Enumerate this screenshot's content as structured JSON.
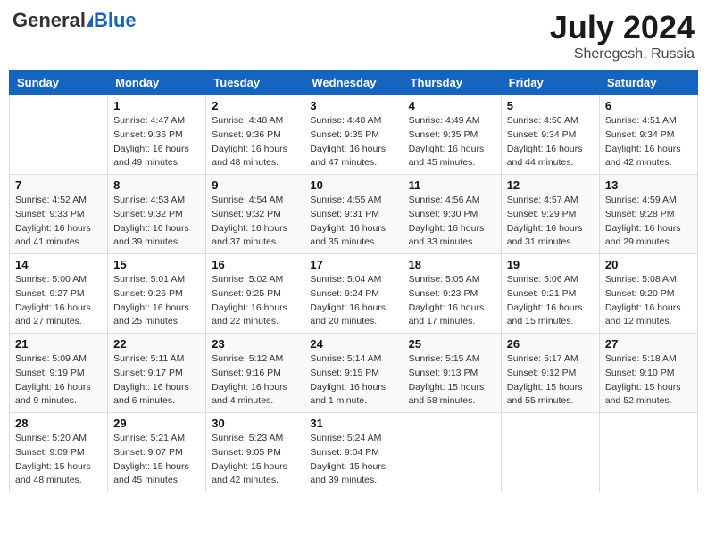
{
  "header": {
    "logo_general": "General",
    "logo_blue": "Blue",
    "title": "July 2024",
    "location": "Sheregesh, Russia"
  },
  "days_of_week": [
    "Sunday",
    "Monday",
    "Tuesday",
    "Wednesday",
    "Thursday",
    "Friday",
    "Saturday"
  ],
  "weeks": [
    [
      {
        "day": "",
        "sunrise": "",
        "sunset": "",
        "daylight": ""
      },
      {
        "day": "1",
        "sunrise": "Sunrise: 4:47 AM",
        "sunset": "Sunset: 9:36 PM",
        "daylight": "Daylight: 16 hours and 49 minutes."
      },
      {
        "day": "2",
        "sunrise": "Sunrise: 4:48 AM",
        "sunset": "Sunset: 9:36 PM",
        "daylight": "Daylight: 16 hours and 48 minutes."
      },
      {
        "day": "3",
        "sunrise": "Sunrise: 4:48 AM",
        "sunset": "Sunset: 9:35 PM",
        "daylight": "Daylight: 16 hours and 47 minutes."
      },
      {
        "day": "4",
        "sunrise": "Sunrise: 4:49 AM",
        "sunset": "Sunset: 9:35 PM",
        "daylight": "Daylight: 16 hours and 45 minutes."
      },
      {
        "day": "5",
        "sunrise": "Sunrise: 4:50 AM",
        "sunset": "Sunset: 9:34 PM",
        "daylight": "Daylight: 16 hours and 44 minutes."
      },
      {
        "day": "6",
        "sunrise": "Sunrise: 4:51 AM",
        "sunset": "Sunset: 9:34 PM",
        "daylight": "Daylight: 16 hours and 42 minutes."
      }
    ],
    [
      {
        "day": "7",
        "sunrise": "Sunrise: 4:52 AM",
        "sunset": "Sunset: 9:33 PM",
        "daylight": "Daylight: 16 hours and 41 minutes."
      },
      {
        "day": "8",
        "sunrise": "Sunrise: 4:53 AM",
        "sunset": "Sunset: 9:32 PM",
        "daylight": "Daylight: 16 hours and 39 minutes."
      },
      {
        "day": "9",
        "sunrise": "Sunrise: 4:54 AM",
        "sunset": "Sunset: 9:32 PM",
        "daylight": "Daylight: 16 hours and 37 minutes."
      },
      {
        "day": "10",
        "sunrise": "Sunrise: 4:55 AM",
        "sunset": "Sunset: 9:31 PM",
        "daylight": "Daylight: 16 hours and 35 minutes."
      },
      {
        "day": "11",
        "sunrise": "Sunrise: 4:56 AM",
        "sunset": "Sunset: 9:30 PM",
        "daylight": "Daylight: 16 hours and 33 minutes."
      },
      {
        "day": "12",
        "sunrise": "Sunrise: 4:57 AM",
        "sunset": "Sunset: 9:29 PM",
        "daylight": "Daylight: 16 hours and 31 minutes."
      },
      {
        "day": "13",
        "sunrise": "Sunrise: 4:59 AM",
        "sunset": "Sunset: 9:28 PM",
        "daylight": "Daylight: 16 hours and 29 minutes."
      }
    ],
    [
      {
        "day": "14",
        "sunrise": "Sunrise: 5:00 AM",
        "sunset": "Sunset: 9:27 PM",
        "daylight": "Daylight: 16 hours and 27 minutes."
      },
      {
        "day": "15",
        "sunrise": "Sunrise: 5:01 AM",
        "sunset": "Sunset: 9:26 PM",
        "daylight": "Daylight: 16 hours and 25 minutes."
      },
      {
        "day": "16",
        "sunrise": "Sunrise: 5:02 AM",
        "sunset": "Sunset: 9:25 PM",
        "daylight": "Daylight: 16 hours and 22 minutes."
      },
      {
        "day": "17",
        "sunrise": "Sunrise: 5:04 AM",
        "sunset": "Sunset: 9:24 PM",
        "daylight": "Daylight: 16 hours and 20 minutes."
      },
      {
        "day": "18",
        "sunrise": "Sunrise: 5:05 AM",
        "sunset": "Sunset: 9:23 PM",
        "daylight": "Daylight: 16 hours and 17 minutes."
      },
      {
        "day": "19",
        "sunrise": "Sunrise: 5:06 AM",
        "sunset": "Sunset: 9:21 PM",
        "daylight": "Daylight: 16 hours and 15 minutes."
      },
      {
        "day": "20",
        "sunrise": "Sunrise: 5:08 AM",
        "sunset": "Sunset: 9:20 PM",
        "daylight": "Daylight: 16 hours and 12 minutes."
      }
    ],
    [
      {
        "day": "21",
        "sunrise": "Sunrise: 5:09 AM",
        "sunset": "Sunset: 9:19 PM",
        "daylight": "Daylight: 16 hours and 9 minutes."
      },
      {
        "day": "22",
        "sunrise": "Sunrise: 5:11 AM",
        "sunset": "Sunset: 9:17 PM",
        "daylight": "Daylight: 16 hours and 6 minutes."
      },
      {
        "day": "23",
        "sunrise": "Sunrise: 5:12 AM",
        "sunset": "Sunset: 9:16 PM",
        "daylight": "Daylight: 16 hours and 4 minutes."
      },
      {
        "day": "24",
        "sunrise": "Sunrise: 5:14 AM",
        "sunset": "Sunset: 9:15 PM",
        "daylight": "Daylight: 16 hours and 1 minute."
      },
      {
        "day": "25",
        "sunrise": "Sunrise: 5:15 AM",
        "sunset": "Sunset: 9:13 PM",
        "daylight": "Daylight: 15 hours and 58 minutes."
      },
      {
        "day": "26",
        "sunrise": "Sunrise: 5:17 AM",
        "sunset": "Sunset: 9:12 PM",
        "daylight": "Daylight: 15 hours and 55 minutes."
      },
      {
        "day": "27",
        "sunrise": "Sunrise: 5:18 AM",
        "sunset": "Sunset: 9:10 PM",
        "daylight": "Daylight: 15 hours and 52 minutes."
      }
    ],
    [
      {
        "day": "28",
        "sunrise": "Sunrise: 5:20 AM",
        "sunset": "Sunset: 9:09 PM",
        "daylight": "Daylight: 15 hours and 48 minutes."
      },
      {
        "day": "29",
        "sunrise": "Sunrise: 5:21 AM",
        "sunset": "Sunset: 9:07 PM",
        "daylight": "Daylight: 15 hours and 45 minutes."
      },
      {
        "day": "30",
        "sunrise": "Sunrise: 5:23 AM",
        "sunset": "Sunset: 9:05 PM",
        "daylight": "Daylight: 15 hours and 42 minutes."
      },
      {
        "day": "31",
        "sunrise": "Sunrise: 5:24 AM",
        "sunset": "Sunset: 9:04 PM",
        "daylight": "Daylight: 15 hours and 39 minutes."
      },
      {
        "day": "",
        "sunrise": "",
        "sunset": "",
        "daylight": ""
      },
      {
        "day": "",
        "sunrise": "",
        "sunset": "",
        "daylight": ""
      },
      {
        "day": "",
        "sunrise": "",
        "sunset": "",
        "daylight": ""
      }
    ]
  ]
}
